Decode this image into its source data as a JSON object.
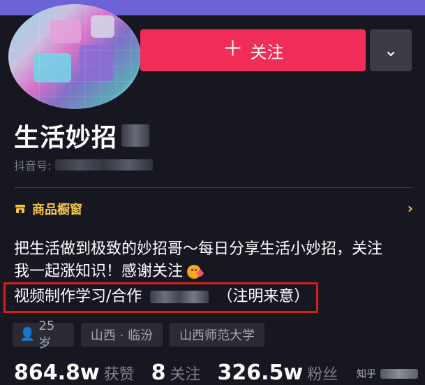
{
  "header": {
    "follow_label": "关注",
    "follow_icon": "plus-icon",
    "dropdown_icon": "chevron-down-icon"
  },
  "profile": {
    "name": "生活妙招",
    "id_label": "抖音号:",
    "shop_label": "商品橱窗",
    "bio_line_1": "把生活做到极致的妙招哥～每日分享生活小妙招，关注",
    "bio_line_2": "我一起涨知识！感谢关注",
    "contact_prefix": "视频制作学习/合作",
    "contact_suffix": "（注明来意）"
  },
  "tags": [
    {
      "label": "25 岁",
      "icon": "person-icon"
    },
    {
      "label": "山西 · 临汾"
    },
    {
      "label": "山西师范大学"
    }
  ],
  "stats": [
    {
      "value": "864.8w",
      "label": "获赞"
    },
    {
      "value": "8",
      "label": "关注"
    },
    {
      "value": "326.5w",
      "label": "粉丝"
    }
  ],
  "watermark": {
    "prefix": "知乎"
  },
  "colors": {
    "background": "#171722",
    "accent": "#ef2d57",
    "shop": "#f5c542",
    "highlight": "#d61d1d"
  }
}
